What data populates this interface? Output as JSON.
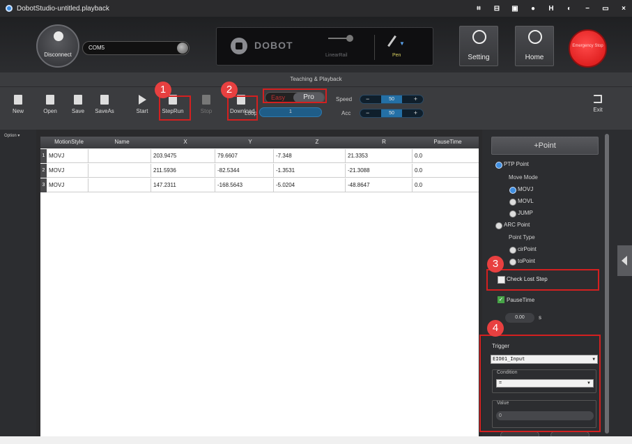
{
  "window": {
    "title": "DobotStudio-untitled.playback",
    "controls": [
      "⌗",
      "⊟",
      "▣",
      "●",
      "H",
      "◐",
      "−",
      "▭",
      "×"
    ]
  },
  "top": {
    "disconnect_label": "Disconnect",
    "port_value": "COM5",
    "logo_text": "DOBOT",
    "linear_rail_label": "LinearRail",
    "end_tool_label": "Pen",
    "setting_label": "Setting",
    "home_label": "Home",
    "estop_label": "Emergency Stop"
  },
  "toolbar": {
    "title": "Teaching & Playback",
    "new": "New",
    "open": "Open",
    "save": "Save",
    "saveas": "SaveAs",
    "start": "Start",
    "steprun": "StepRun",
    "stop": "Stop",
    "download": "Download",
    "easy": "Easy",
    "pro": "Pro",
    "loop_label": "Loop",
    "loop_value": "1",
    "speed_label": "Speed",
    "speed_value": "50",
    "acc_label": "Acc",
    "acc_value": "50",
    "minus": "−",
    "plus": "+",
    "exit": "Exit"
  },
  "left": {
    "option_label": "Option ▾"
  },
  "table": {
    "headers": [
      "MotionStyle",
      "Name",
      "X",
      "Y",
      "Z",
      "R",
      "PauseTime"
    ],
    "rows": [
      {
        "index": "1",
        "style": "MOVJ",
        "name": "",
        "x": "203.9475",
        "y": "79.6607",
        "z": "-7.348",
        "r": "21.3353",
        "pause": "0.0"
      },
      {
        "index": "2",
        "style": "MOVJ",
        "name": "",
        "x": "211.5936",
        "y": "-82.5344",
        "z": "-1.3531",
        "r": "-21.3088",
        "pause": "0.0"
      },
      {
        "index": "3",
        "style": "MOVJ",
        "name": "",
        "x": "147.2311",
        "y": "-168.5643",
        "z": "-5.0204",
        "r": "-48.8647",
        "pause": "0.0"
      }
    ]
  },
  "panel": {
    "point_button": "+Point",
    "ptp_point": "PTP Point",
    "move_mode": "Move Mode",
    "movj": "MOVJ",
    "movl": "MOVL",
    "jump": "JUMP",
    "arc_point": "ARC Point",
    "point_type": "Point Type",
    "cir_point": "cirPoint",
    "to_point": "toPoint",
    "check_lost_step": "Check Lost Step",
    "pause_time": "PauseTime",
    "pause_value": "0.00",
    "pause_unit": "s",
    "trigger_label": "Trigger",
    "trigger_value": "EIO01_Input",
    "condition_label": "Condition",
    "condition_value": "=",
    "value_label": "Value",
    "value_value": "0"
  },
  "annotations": {
    "b1": "1",
    "b2": "2",
    "b3": "3",
    "b4": "4"
  },
  "colors": {
    "accent": "#2470a6",
    "highlight": "#d42020",
    "estop": "#d41010"
  }
}
